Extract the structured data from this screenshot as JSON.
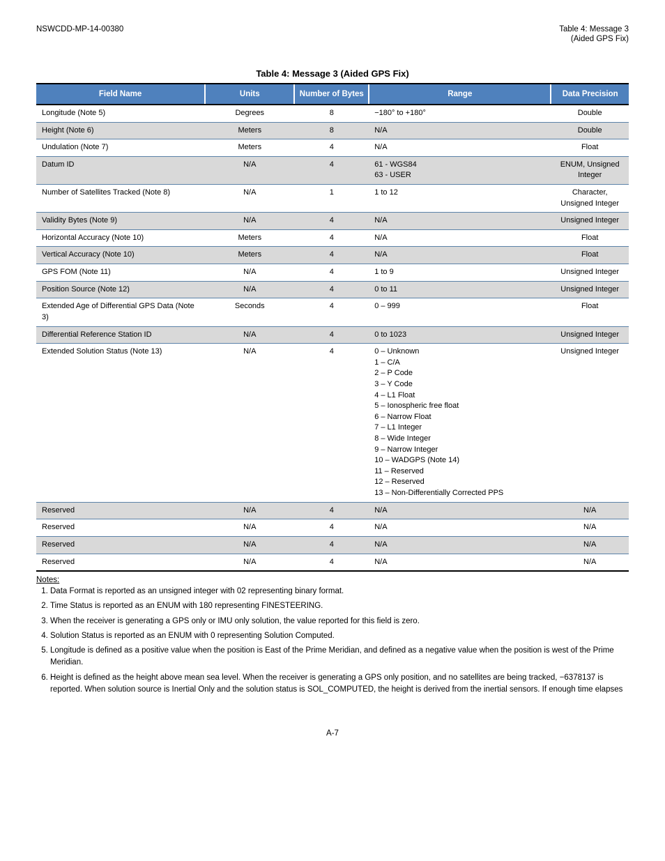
{
  "header": {
    "left": "NSWCDD-MP-14-00380",
    "right_label": "Table 4: Message 3",
    "right_sub": "(Aided GPS Fix)"
  },
  "table": {
    "title": "Table 4: Message 3 (Aided GPS Fix)",
    "columns": [
      "Field Name",
      "Units",
      "Number of Bytes",
      "Range",
      "Data Precision"
    ],
    "rows": [
      {
        "shade": false,
        "cells": [
          "Longitude (Note 5)",
          "Degrees",
          "8",
          "−180° to +180°",
          "Double"
        ]
      },
      {
        "shade": true,
        "cells": [
          "Height (Note 6)",
          "Meters",
          "8",
          "N/A",
          "Double"
        ]
      },
      {
        "shade": false,
        "cells": [
          "Undulation (Note 7)",
          "Meters",
          "4",
          "N/A",
          "Float"
        ]
      },
      {
        "shade": true,
        "cells": [
          "Datum ID",
          "N/A",
          "4",
          "61 - WGS84\n63 - USER",
          "ENUM, Unsigned Integer"
        ]
      },
      {
        "shade": false,
        "cells": [
          "Number of Satellites Tracked (Note 8)",
          "N/A",
          "1",
          "1 to 12",
          "Character, Unsigned Integer"
        ]
      },
      {
        "shade": true,
        "cells": [
          "Validity Bytes (Note 9)",
          "N/A",
          "4",
          "N/A",
          "Unsigned Integer"
        ]
      },
      {
        "shade": false,
        "cells": [
          "Horizontal Accuracy (Note 10)",
          "Meters",
          "4",
          "N/A",
          "Float"
        ]
      },
      {
        "shade": true,
        "cells": [
          "Vertical Accuracy (Note 10)",
          "Meters",
          "4",
          "N/A",
          "Float"
        ]
      },
      {
        "shade": false,
        "cells": [
          "GPS FOM (Note 11)",
          "N/A",
          "4",
          "1 to 9",
          "Unsigned Integer"
        ]
      },
      {
        "shade": true,
        "cells": [
          "Position Source (Note 12)",
          "N/A",
          "4",
          "0 to 11",
          "Unsigned Integer"
        ]
      },
      {
        "shade": false,
        "cells": [
          "Extended Age of Differential GPS Data (Note 3)",
          "Seconds",
          "4",
          "0 – 999",
          "Float"
        ]
      },
      {
        "shade": true,
        "cells": [
          "Differential Reference Station ID",
          "N/A",
          "4",
          "0 to 1023",
          "Unsigned Integer"
        ]
      },
      {
        "shade": false,
        "cells": [
          "Extended Solution Status (Note 13)",
          "N/A",
          "4",
          "0 – Unknown\n1 – C/A\n2 – P Code\n3 – Y Code\n4 – L1 Float\n5 – Ionospheric free float\n6 – Narrow Float\n7 – L1 Integer\n8 – Wide Integer\n9 – Narrow Integer\n10 – WADGPS (Note 14)\n11 – Reserved\n12 – Reserved\n13 – Non-Differentially Corrected PPS",
          "Unsigned Integer"
        ]
      },
      {
        "shade": true,
        "cells": [
          "Reserved",
          "N/A",
          "4",
          "N/A",
          "N/A"
        ]
      },
      {
        "shade": false,
        "cells": [
          "Reserved",
          "N/A",
          "4",
          "N/A",
          "N/A"
        ]
      },
      {
        "shade": true,
        "cells": [
          "Reserved",
          "N/A",
          "4",
          "N/A",
          "N/A"
        ]
      },
      {
        "shade": false,
        "cells": [
          "Reserved",
          "N/A",
          "4",
          "N/A",
          "N/A"
        ]
      }
    ],
    "notes_label": "Notes:",
    "notes": [
      "Data Format is reported as an unsigned integer with 02 representing binary format.",
      "Time Status is reported as an ENUM with 180 representing FINESTEERING.",
      "When the receiver is generating a GPS only or IMU only solution, the value reported for this field is zero.",
      "Solution Status is reported as an ENUM with 0 representing Solution Computed.",
      "Longitude is defined as a positive value when the position is East of the Prime Meridian, and defined as a negative value when the position is west of the Prime Meridian.",
      "Height is defined as the height above mean sea level.  When the receiver is generating a GPS only position, and no satellites are being tracked, −6378137 is reported.  When solution source is Inertial Only and the solution status is SOL_COMPUTED, the height is derived from the inertial sensors.  If enough time elapses"
    ]
  },
  "footer": {
    "page": "A-7"
  }
}
